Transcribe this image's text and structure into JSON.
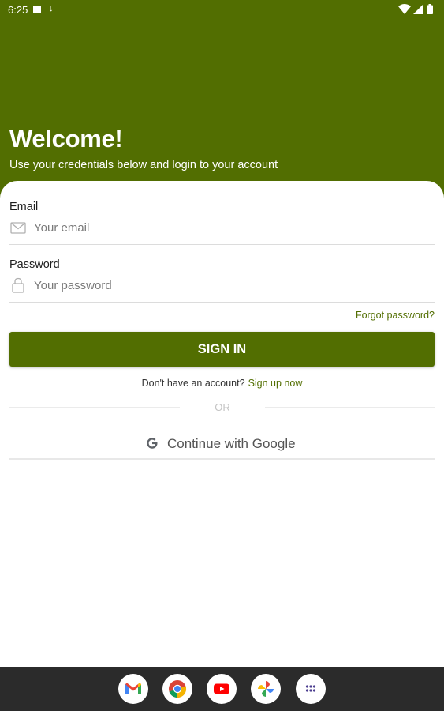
{
  "status_bar": {
    "time": "6:25"
  },
  "header": {
    "title": "Welcome!",
    "subtitle": "Use your credentials below and login to your account"
  },
  "form": {
    "email": {
      "label": "Email",
      "placeholder": "Your email",
      "icon": "mail-icon"
    },
    "password": {
      "label": "Password",
      "placeholder": "Your password",
      "icon": "lock-icon"
    },
    "forgot_label": "Forgot password?",
    "signin_label": "SIGN IN",
    "signup_prompt": "Don't have an account?",
    "signup_link": "Sign up now",
    "or_label": "OR",
    "google_label": "Continue with Google"
  },
  "dock": {
    "apps": [
      "gmail-icon",
      "chrome-icon",
      "youtube-icon",
      "photos-icon",
      "app-drawer-icon"
    ]
  },
  "colors": {
    "primary": "#526e01",
    "navbar": "#2b2b2b",
    "background": "#ffffff"
  }
}
